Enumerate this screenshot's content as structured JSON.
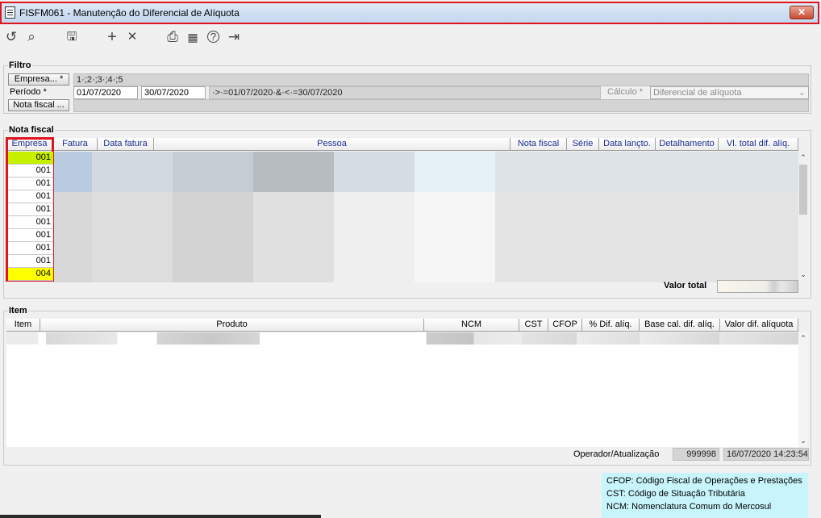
{
  "window": {
    "title": "FISFM061 - Manutenção do Diferencial de Alíquota",
    "close_label": "✕"
  },
  "toolbar": [
    {
      "name": "refresh-icon",
      "glyph": "↺"
    },
    {
      "name": "search-icon",
      "glyph": "⌕"
    },
    {
      "name": "save-icon",
      "glyph": "🖫"
    },
    {
      "name": "add-icon",
      "glyph": "+"
    },
    {
      "name": "delete-icon",
      "glyph": "✕"
    },
    {
      "name": "print-icon",
      "glyph": "⎙"
    },
    {
      "name": "calendar-icon",
      "glyph": "▦"
    },
    {
      "name": "help-icon",
      "glyph": "?"
    },
    {
      "name": "exit-icon",
      "glyph": "⇥"
    }
  ],
  "filtro": {
    "label": "Filtro",
    "empresa_button": "Empresa... *",
    "empresa_value": "1·;2·;3·;4·;5",
    "periodo_label": "Período *",
    "periodo_start": "01/07/2020",
    "periodo_end": "30/07/2020",
    "periodo_expr": "·>·=01/07/2020·&·<·=30/07/2020",
    "calculo_label": "Cálculo *",
    "calculo_value": "Diferencial de alíquota",
    "nota_button": "Nota fiscal ..."
  },
  "nota_fiscal": {
    "label": "Nota fiscal",
    "columns": [
      "Empresa",
      "Fatura",
      "Data fatura",
      "Pessoa",
      "Nota fiscal",
      "Série",
      "Data lançto.",
      "Detalhamento",
      "Vl. total dif. alíq."
    ],
    "empresa_rows": [
      "001",
      "001",
      "001",
      "001",
      "001",
      "001",
      "001",
      "001",
      "001",
      "004"
    ],
    "valor_total_label": "Valor total"
  },
  "item": {
    "label": "Item",
    "columns": [
      "Item",
      "Produto",
      "NCM",
      "CST",
      "CFOP",
      "% Dif. alíq.",
      "Base cal. dif. alíq.",
      "Valor dif. alíquota"
    ],
    "operador_label": "Operador/Atualização",
    "operador_value": "999998",
    "atualizacao_value": "16/07/2020 14:23:54"
  },
  "legend": [
    "CFOP: Código Fiscal de Operações e Prestações",
    "CST: Código de Situação Tributária",
    "NCM: Nomenclatura Comum do Mercosul"
  ],
  "colors": {
    "highlight_border": "#e0141c",
    "row_lime": "#c5f000",
    "row_yellow": "#ffff00",
    "legend_bg": "#c8f4fb"
  }
}
